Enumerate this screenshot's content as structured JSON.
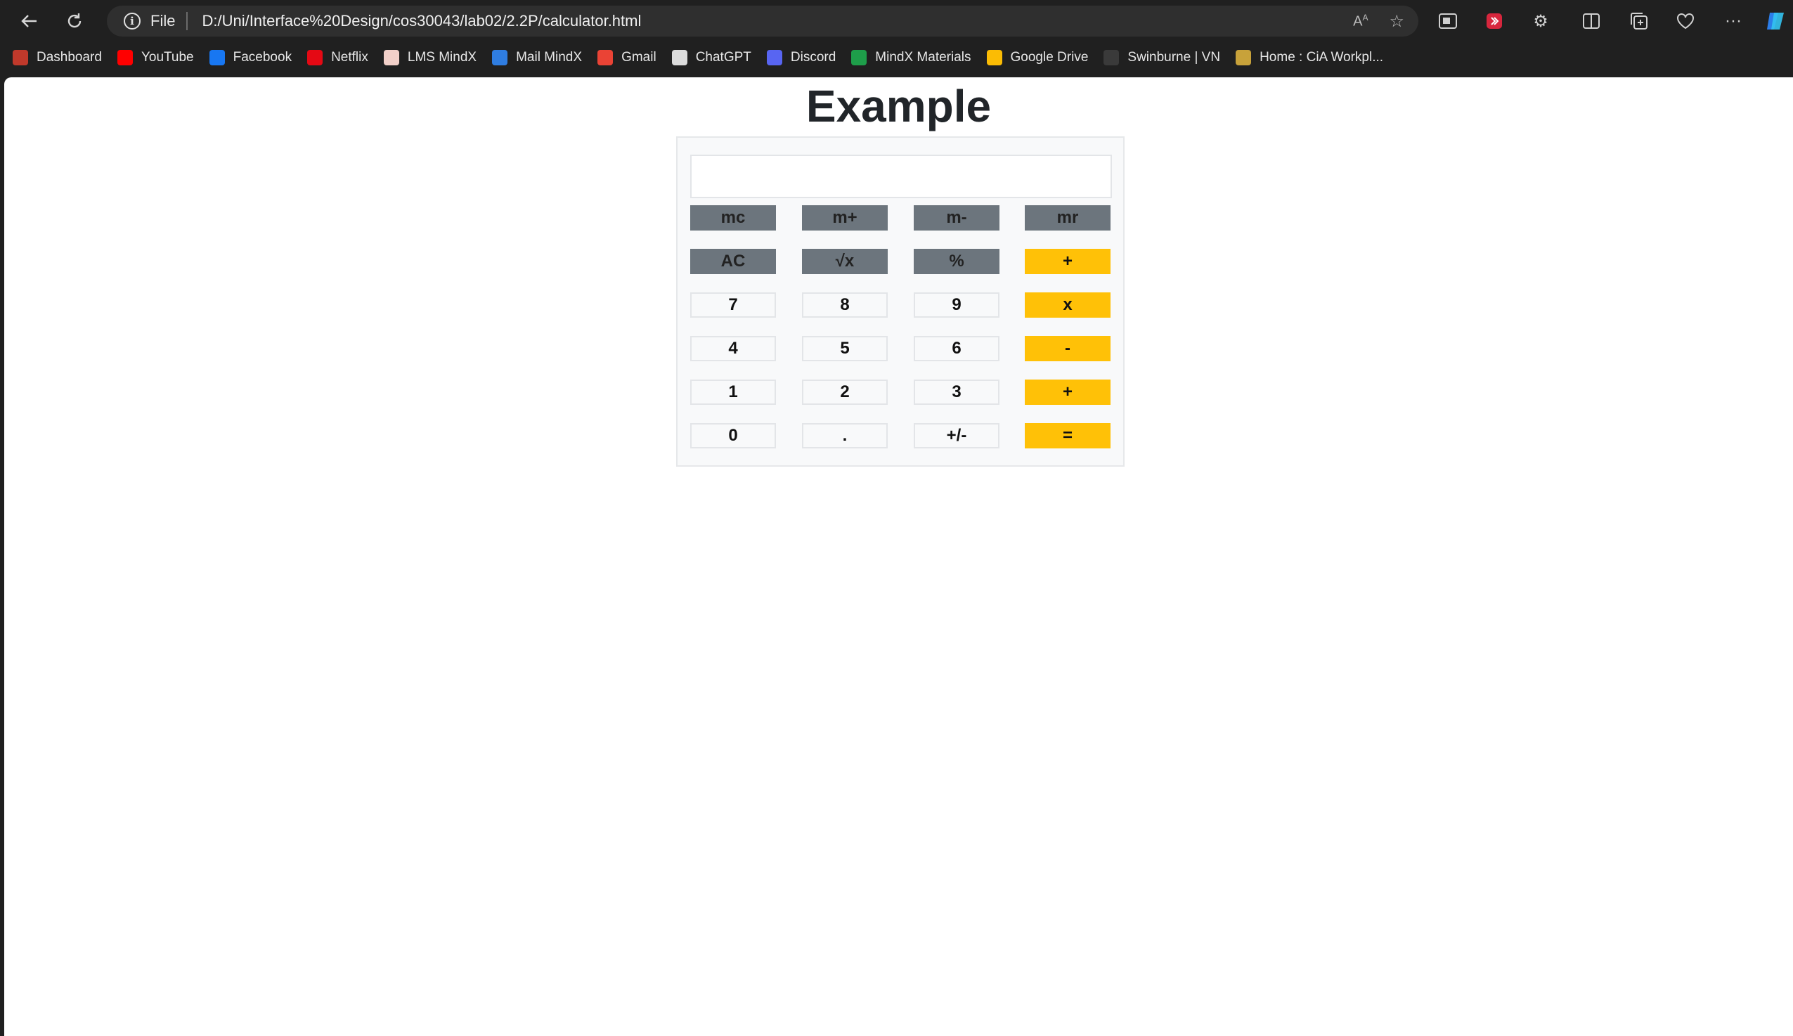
{
  "browser": {
    "url": "D:/Uni/Interface%20Design/cos30043/lab02/2.2P/calculator.html",
    "scheme_label": "File",
    "bookmarks": [
      {
        "label": "Dashboard",
        "icon": "dashboard-icon",
        "color": "#c0392b"
      },
      {
        "label": "YouTube",
        "icon": "youtube-icon",
        "color": "#ff0000"
      },
      {
        "label": "Facebook",
        "icon": "facebook-icon",
        "color": "#1877f2"
      },
      {
        "label": "Netflix",
        "icon": "netflix-icon",
        "color": "#e50914"
      },
      {
        "label": "LMS MindX",
        "icon": "lms-icon",
        "color": "#f2d0c9"
      },
      {
        "label": "Mail MindX",
        "icon": "mail-icon",
        "color": "#2f7de1"
      },
      {
        "label": "Gmail",
        "icon": "gmail-icon",
        "color": "#ea4335"
      },
      {
        "label": "ChatGPT",
        "icon": "chatgpt-icon",
        "color": "#dcdcdc"
      },
      {
        "label": "Discord",
        "icon": "discord-icon",
        "color": "#5865f2"
      },
      {
        "label": "MindX Materials",
        "icon": "sheets-icon",
        "color": "#1e9e4a"
      },
      {
        "label": "Google Drive",
        "icon": "drive-icon",
        "color": "#fbbc04"
      },
      {
        "label": "Swinburne | VN",
        "icon": "page-icon",
        "color": "#3a3a3a"
      },
      {
        "label": "Home : CiA Workpl...",
        "icon": "cia-icon",
        "color": "#c8a23a"
      }
    ]
  },
  "page": {
    "title": "Example",
    "display_value": ""
  },
  "calculator": {
    "rows": [
      [
        {
          "label": "mc",
          "style": "gray"
        },
        {
          "label": "m+",
          "style": "gray"
        },
        {
          "label": "m-",
          "style": "gray"
        },
        {
          "label": "mr",
          "style": "gray"
        }
      ],
      [
        {
          "label": "AC",
          "style": "gray"
        },
        {
          "label": "√x",
          "style": "gray"
        },
        {
          "label": "%",
          "style": "gray"
        },
        {
          "label": "+",
          "style": "yellow"
        }
      ],
      [
        {
          "label": "7",
          "style": "light"
        },
        {
          "label": "8",
          "style": "light"
        },
        {
          "label": "9",
          "style": "light"
        },
        {
          "label": "x",
          "style": "yellow"
        }
      ],
      [
        {
          "label": "4",
          "style": "light"
        },
        {
          "label": "5",
          "style": "light"
        },
        {
          "label": "6",
          "style": "light"
        },
        {
          "label": "-",
          "style": "yellow"
        }
      ],
      [
        {
          "label": "1",
          "style": "light"
        },
        {
          "label": "2",
          "style": "light"
        },
        {
          "label": "3",
          "style": "light"
        },
        {
          "label": "+",
          "style": "yellow"
        }
      ],
      [
        {
          "label": "0",
          "style": "light"
        },
        {
          "label": ".",
          "style": "light"
        },
        {
          "label": "+/-",
          "style": "light"
        },
        {
          "label": "=",
          "style": "yellow"
        }
      ]
    ],
    "colors": {
      "gray": "#6c757d",
      "yellow": "#ffc107",
      "light": "#f8f9fa"
    }
  }
}
